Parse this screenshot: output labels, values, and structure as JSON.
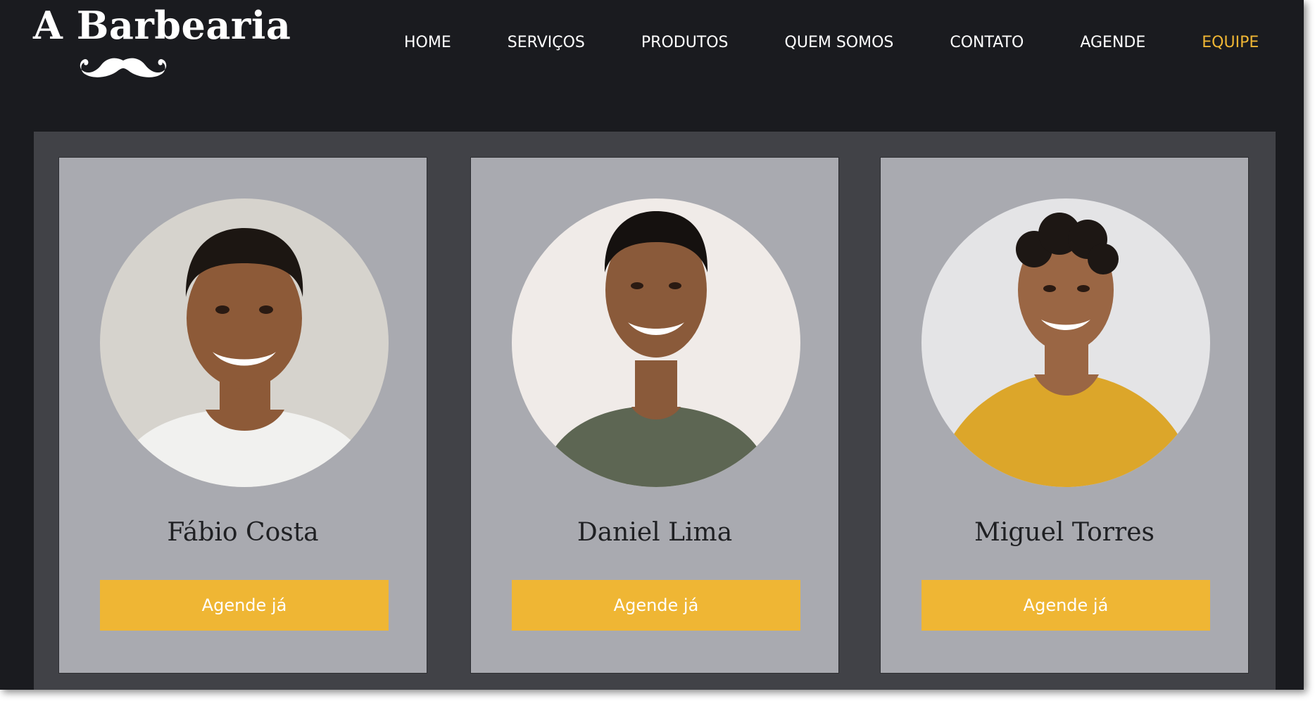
{
  "brand": {
    "name": "A Barbearia",
    "logo_icon": "mustache-icon"
  },
  "nav": {
    "active_color": "#efb634",
    "items": [
      {
        "label": "HOME"
      },
      {
        "label": "SERVIÇOS"
      },
      {
        "label": "PRODUTOS"
      },
      {
        "label": "QUEM SOMOS"
      },
      {
        "label": "CONTATO"
      },
      {
        "label": "AGENDE"
      },
      {
        "label": "EQUIPE",
        "active": true
      }
    ]
  },
  "team": [
    {
      "name": "Fábio Costa",
      "button": "Agende já",
      "shirt_color": "#f1f1ef"
    },
    {
      "name": "Daniel Lima",
      "button": "Agende já",
      "shirt_color": "#5d6653"
    },
    {
      "name": "Miguel Torres",
      "button": "Agende já",
      "shirt_color": "#dca62a"
    }
  ],
  "colors": {
    "page_background": "#1a1b1f",
    "panel_background": "#414247",
    "card_background": "#a9aab0",
    "accent": "#efb634"
  }
}
